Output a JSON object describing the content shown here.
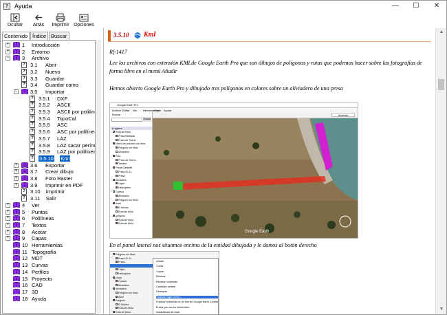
{
  "window": {
    "title": "Ayuda",
    "controls": {
      "minimize": "—",
      "maximize": "☐",
      "close": "✕"
    }
  },
  "toolbar": {
    "hide_label": "Ocultar",
    "back_label": "Atrás",
    "print_label": "Imprimir",
    "options_label": "Opciones"
  },
  "nav_tabs": {
    "contents": "Contenido",
    "index": "Índice",
    "search": "Buscar"
  },
  "tree": [
    {
      "num": "1",
      "label": "Introducción",
      "type": "book",
      "expander": "+"
    },
    {
      "num": "2",
      "label": "Entorno",
      "type": "book",
      "expander": "+"
    },
    {
      "num": "3",
      "label": "Archivo",
      "type": "book",
      "expander": "−"
    },
    {
      "num": "3.1",
      "label": "Abrir",
      "type": "page"
    },
    {
      "num": "3.2",
      "label": "Nuevo",
      "type": "page"
    },
    {
      "num": "3.3",
      "label": "Guardar",
      "type": "page"
    },
    {
      "num": "3.4",
      "label": "Guardar como",
      "type": "page"
    },
    {
      "num": "3.5",
      "label": "Importar",
      "type": "book",
      "expander": "−"
    },
    {
      "num": "3.5.1",
      "label": "DXF",
      "type": "page"
    },
    {
      "num": "3.5.2",
      "label": "ASCII",
      "type": "page"
    },
    {
      "num": "3.5.3",
      "label": "ASCII por polilínea",
      "type": "page"
    },
    {
      "num": "3.5.4",
      "label": "TopoCal",
      "type": "page"
    },
    {
      "num": "3.5.5",
      "label": "ASC",
      "type": "page"
    },
    {
      "num": "3.5.6",
      "label": "ASC  por polilínea",
      "type": "page"
    },
    {
      "num": "3.5.7",
      "label": "LAZ",
      "type": "page"
    },
    {
      "num": "3.5.8",
      "label": "LAZ sacar perímetro",
      "type": "page"
    },
    {
      "num": "3.5.9",
      "label": "LAZ por polilínea",
      "type": "page"
    },
    {
      "num": "3.5.10",
      "label": "Kml",
      "type": "page",
      "selected": true
    },
    {
      "num": "3.6",
      "label": "Exportar",
      "type": "book",
      "expander": "+"
    },
    {
      "num": "3.7",
      "label": "Crear dibujo",
      "type": "book",
      "expander": "+"
    },
    {
      "num": "3.8",
      "label": "Foto Raster",
      "type": "book",
      "expander": "+"
    },
    {
      "num": "3.9",
      "label": "Imprimir en PDF",
      "type": "book",
      "expander": "+"
    },
    {
      "num": "3.10",
      "label": "Imprimir",
      "type": "page"
    },
    {
      "num": "3.11",
      "label": "Salir",
      "type": "page"
    },
    {
      "num": "4",
      "label": "Ver",
      "type": "book",
      "expander": "+"
    },
    {
      "num": "5",
      "label": "Puntos",
      "type": "book",
      "expander": "+"
    },
    {
      "num": "6",
      "label": "Polilíneas",
      "type": "book",
      "expander": "+"
    },
    {
      "num": "7",
      "label": "Textos",
      "type": "book",
      "expander": "+"
    },
    {
      "num": "8",
      "label": "Acotar",
      "type": "book",
      "expander": "+"
    },
    {
      "num": "9",
      "label": "Capas",
      "type": "book",
      "expander": "+"
    },
    {
      "num": "10",
      "label": "Herramientas",
      "type": "book"
    },
    {
      "num": "11",
      "label": "Topografía",
      "type": "book"
    },
    {
      "num": "12",
      "label": "MDT",
      "type": "book"
    },
    {
      "num": "13",
      "label": "Curvas",
      "type": "book"
    },
    {
      "num": "14",
      "label": "Perfiles",
      "type": "book"
    },
    {
      "num": "15",
      "label": "Proyecto",
      "type": "book"
    },
    {
      "num": "16",
      "label": "CAD",
      "type": "book"
    },
    {
      "num": "17",
      "label": "3D",
      "type": "book"
    },
    {
      "num": "18",
      "label": "Ayuda",
      "type": "book"
    }
  ],
  "topic": {
    "number": "3.5.10",
    "title": "Kml",
    "ref": "Rf-1417",
    "paragraph1": "Lee los archivos con extensión  KMLde Google Earth Pro que son dibujos de polígonos y rutas que podemos hacer sobre las fotografías de forma libre en el menú Añadir",
    "paragraph2": "Hemos abierto Google Earth Pro y dibujado tres polígonos en colores sobre un aliviadero de una presa",
    "paragraph3": "En el panel lateral nos situamos encima de la entidad dibujada y le damos al botón derecho"
  },
  "screenshot1": {
    "app_title": "Google Earth Pro",
    "menu": [
      "Archivo",
      "Editar",
      "Ver",
      "Herramientas",
      "Añadir",
      "Ayuda"
    ],
    "search_label": "Buscar",
    "search_button": "Buscar",
    "places_label": "Lugares",
    "login_button": "Acceder",
    "watermark": "Google Earth",
    "layers": [
      "Ruta sin título",
      "Presa Barbada",
      "Presa de Tuerto",
      "Marca de posición sin título",
      "Polígono sin título",
      "Aliviadero",
      "Foto",
      "Presa de Tuerto",
      "Tarrasa",
      "Presa Castellet",
      "Presa 20-11",
      "Presa",
      "Aliviadero",
      "Cajón",
      "Helicóptero",
      "Guarda",
      "Aliviadero",
      "Polígono sin título",
      "Aviel",
      "El Mundo",
      "Ruta sin título",
      "polígono",
      "Ruta sin título",
      "Ruta sin título"
    ]
  },
  "screenshot2": {
    "layers": [
      "Polígono sin título",
      "Presa 20-11",
      "Presa",
      "Aliviadero",
      "Cajón",
      "Helicóptero",
      "pínca",
      "Guarda",
      "Aliviadero",
      "Aliviadero",
      "Polígono sin título",
      "Aviel",
      "Polígono",
      "El Mundo",
      "Ruta sin título",
      "Ruta sin título"
    ],
    "context_menu": [
      "Añadir",
      "Cortar",
      "Copiar",
      "Eliminar",
      "Eliminar contenido",
      "Cambiar nombre",
      "Deshacer",
      "Guardar lugar como...",
      "Publicar contenido en el foro de Google Earth Community",
      "Enviar por correo electrónico",
      "Instantánea de vista"
    ]
  },
  "colors": {
    "selection": "#0a64c8",
    "topic_accent": "#e06010",
    "topic_title": "#e00000",
    "polygon_red": "#e03020",
    "polygon_green": "#30c030",
    "polygon_magenta": "#d020d0"
  }
}
